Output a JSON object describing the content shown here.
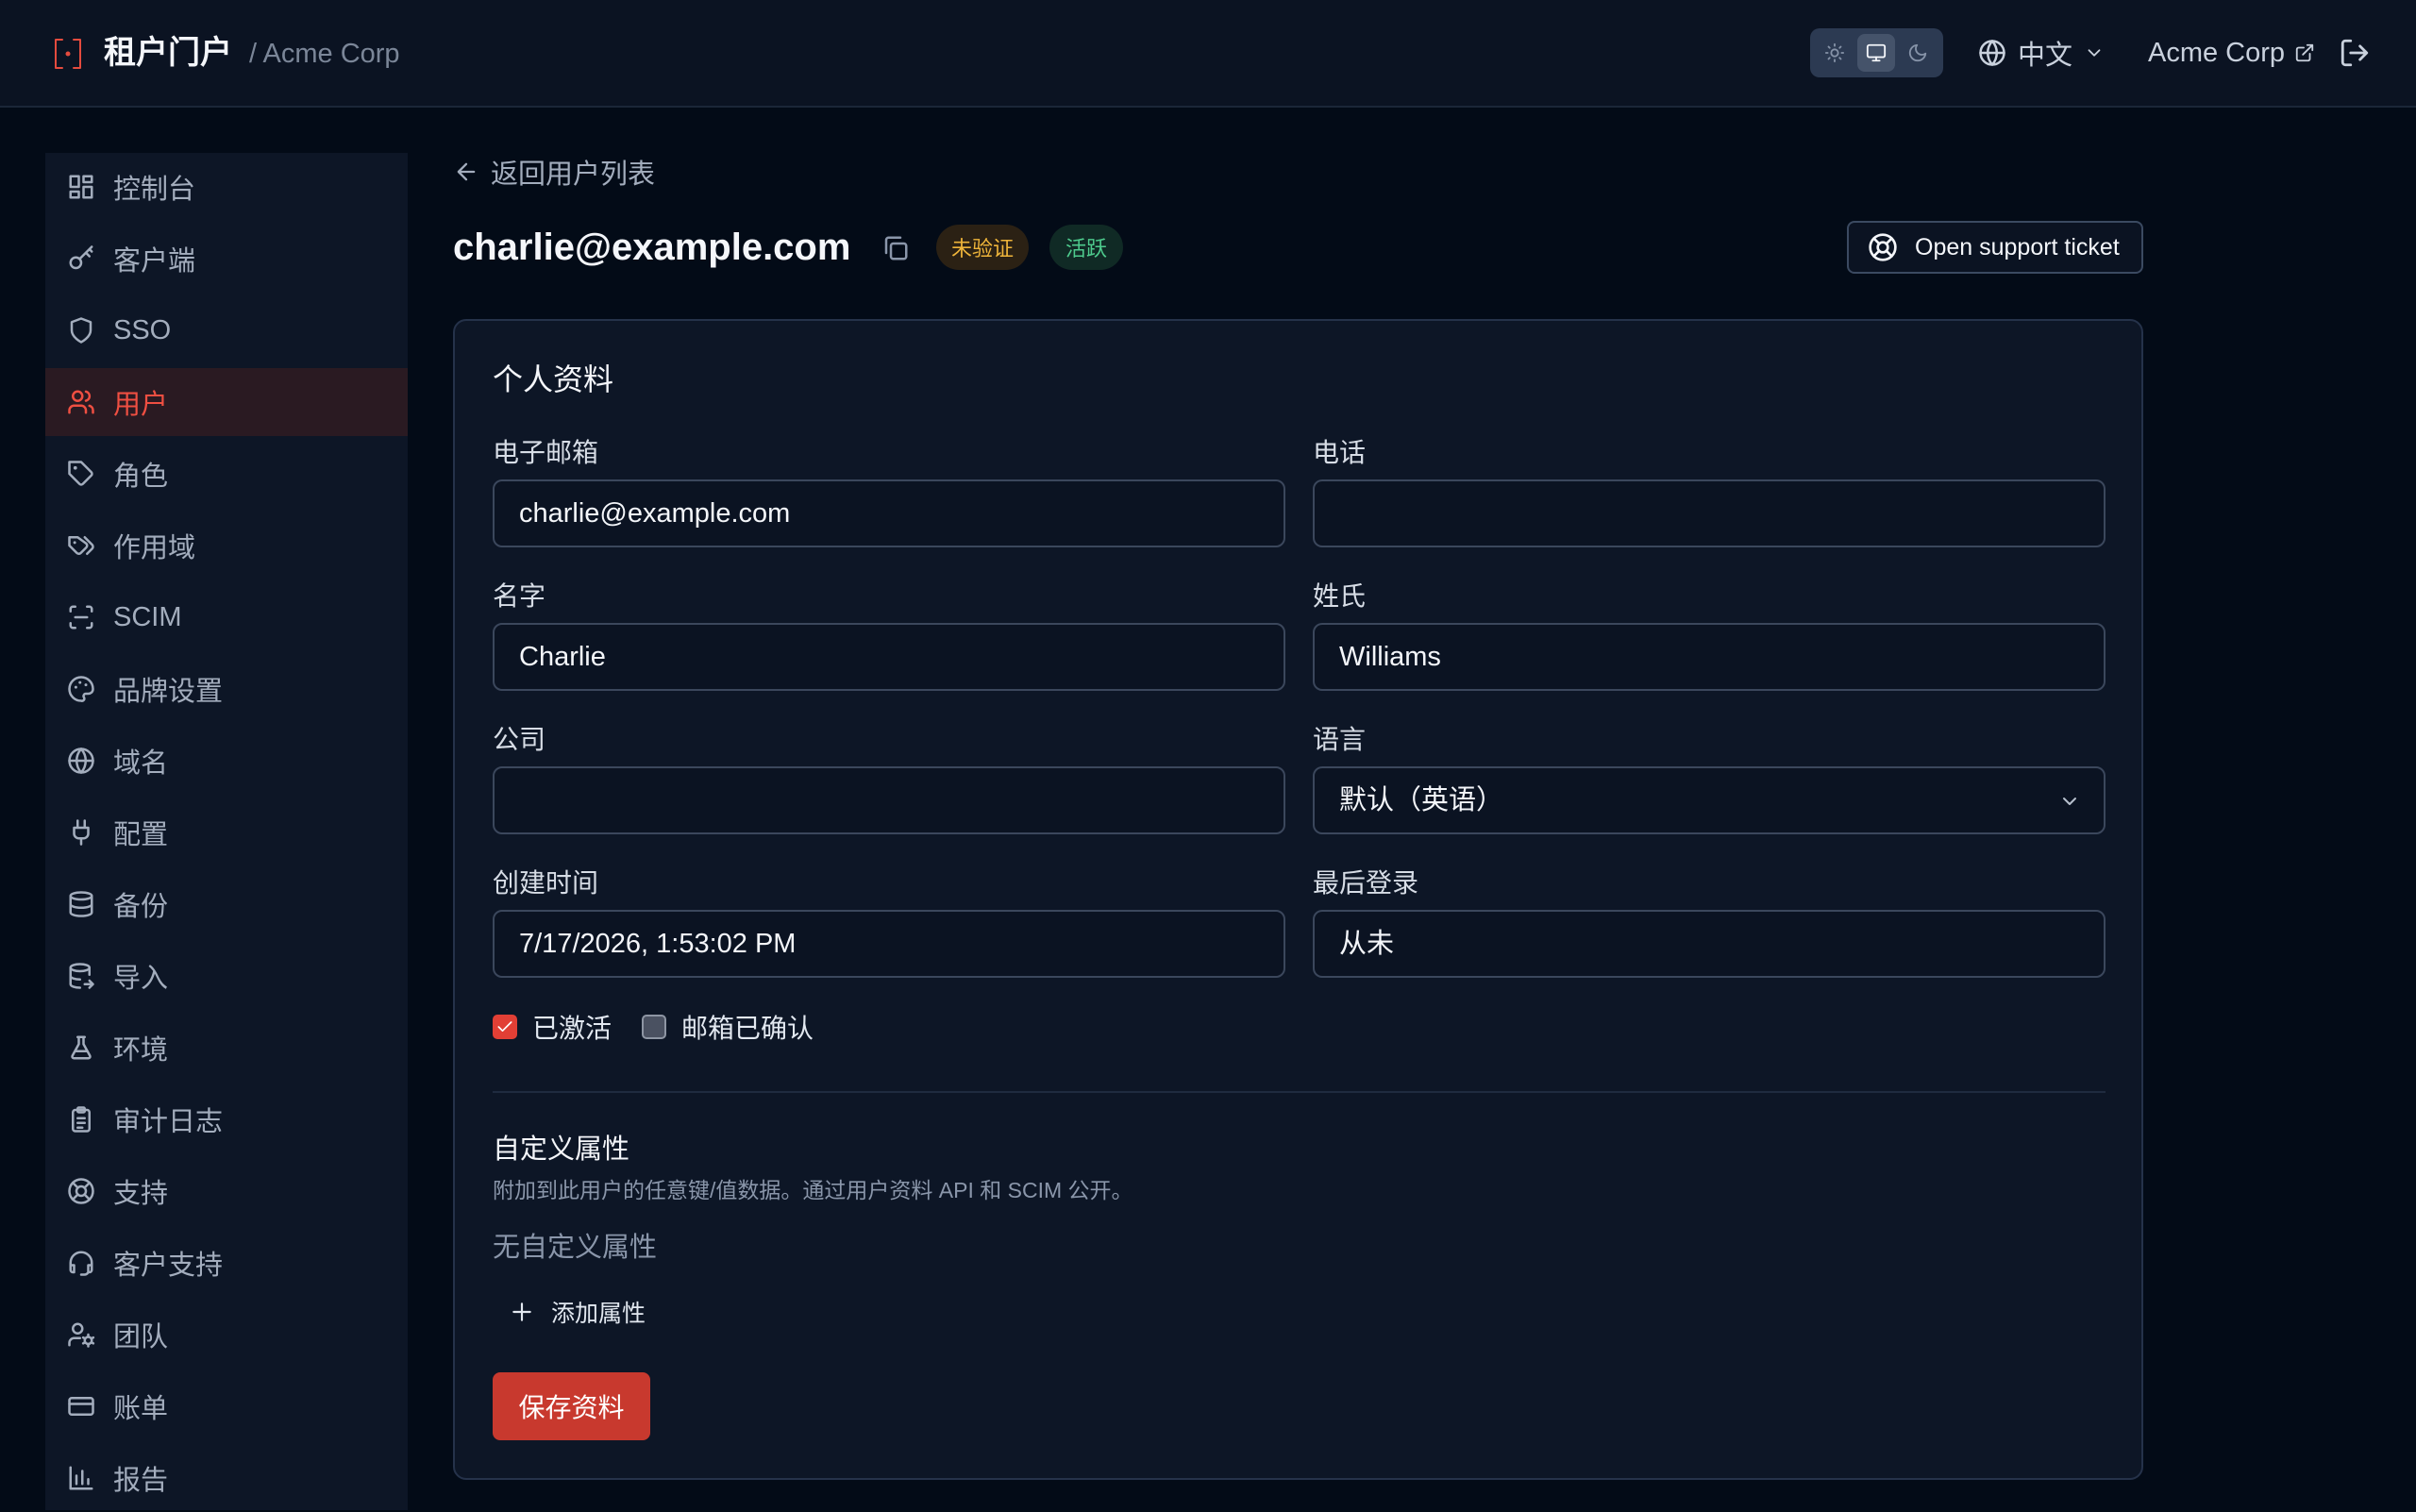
{
  "header": {
    "logo_icon": "bracket-dot-logo-icon",
    "title": "租户门户",
    "org_breadcrumb": "/ Acme Corp",
    "theme_options": [
      "light",
      "system",
      "dark"
    ],
    "theme_selected": "system",
    "language": "中文",
    "org_link": "Acme Corp",
    "logout_icon": "logout-icon"
  },
  "sidebar": {
    "items": [
      {
        "label": "控制台",
        "icon": "dashboard-icon"
      },
      {
        "label": "客户端",
        "icon": "key-icon"
      },
      {
        "label": "SSO",
        "icon": "shield-icon"
      },
      {
        "label": "用户",
        "icon": "users-icon",
        "active": true
      },
      {
        "label": "角色",
        "icon": "tag-icon"
      },
      {
        "label": "作用域",
        "icon": "tags-icon"
      },
      {
        "label": "SCIM",
        "icon": "scan-icon"
      },
      {
        "label": "品牌设置",
        "icon": "palette-icon"
      },
      {
        "label": "域名",
        "icon": "globe-icon"
      },
      {
        "label": "配置",
        "icon": "plug-icon"
      },
      {
        "label": "备份",
        "icon": "database-icon"
      },
      {
        "label": "导入",
        "icon": "database-import-icon"
      },
      {
        "label": "环境",
        "icon": "flask-icon"
      },
      {
        "label": "审计日志",
        "icon": "clipboard-icon"
      },
      {
        "label": "支持",
        "icon": "lifebuoy-icon"
      },
      {
        "label": "客户支持",
        "icon": "headset-icon"
      },
      {
        "label": "团队",
        "icon": "user-cog-icon"
      },
      {
        "label": "账单",
        "icon": "credit-card-icon"
      },
      {
        "label": "报告",
        "icon": "bar-chart-icon"
      }
    ]
  },
  "main": {
    "back_label": "返回用户列表",
    "email_title": "charlie@example.com",
    "badges": {
      "unverified": "未验证",
      "active": "活跃"
    },
    "support_button": "Open support ticket",
    "profile": {
      "title": "个人资料",
      "email_label": "电子邮箱",
      "email_value": "charlie@example.com",
      "phone_label": "电话",
      "phone_value": "",
      "first_name_label": "名字",
      "first_name_value": "Charlie",
      "last_name_label": "姓氏",
      "last_name_value": "Williams",
      "company_label": "公司",
      "company_value": "",
      "language_label": "语言",
      "language_value": "默认（英语）",
      "created_label": "创建时间",
      "created_value": "7/17/2026, 1:53:02 PM",
      "last_login_label": "最后登录",
      "last_login_value": "从未",
      "activated_label": "已激活",
      "activated_checked": true,
      "email_confirmed_label": "邮箱已确认",
      "email_confirmed_checked": false
    },
    "custom_attributes": {
      "title": "自定义属性",
      "description": "附加到此用户的任意键/值数据。通过用户资料 API 和 SCIM 公开。",
      "empty": "无自定义属性",
      "add_label": "添加属性"
    },
    "save_button": "保存资料"
  },
  "colors": {
    "accent": "#e23f35",
    "background": "#030b17",
    "panel": "#0d1626",
    "warning_badge": "#efb53a",
    "success_badge": "#4ecb8d"
  }
}
